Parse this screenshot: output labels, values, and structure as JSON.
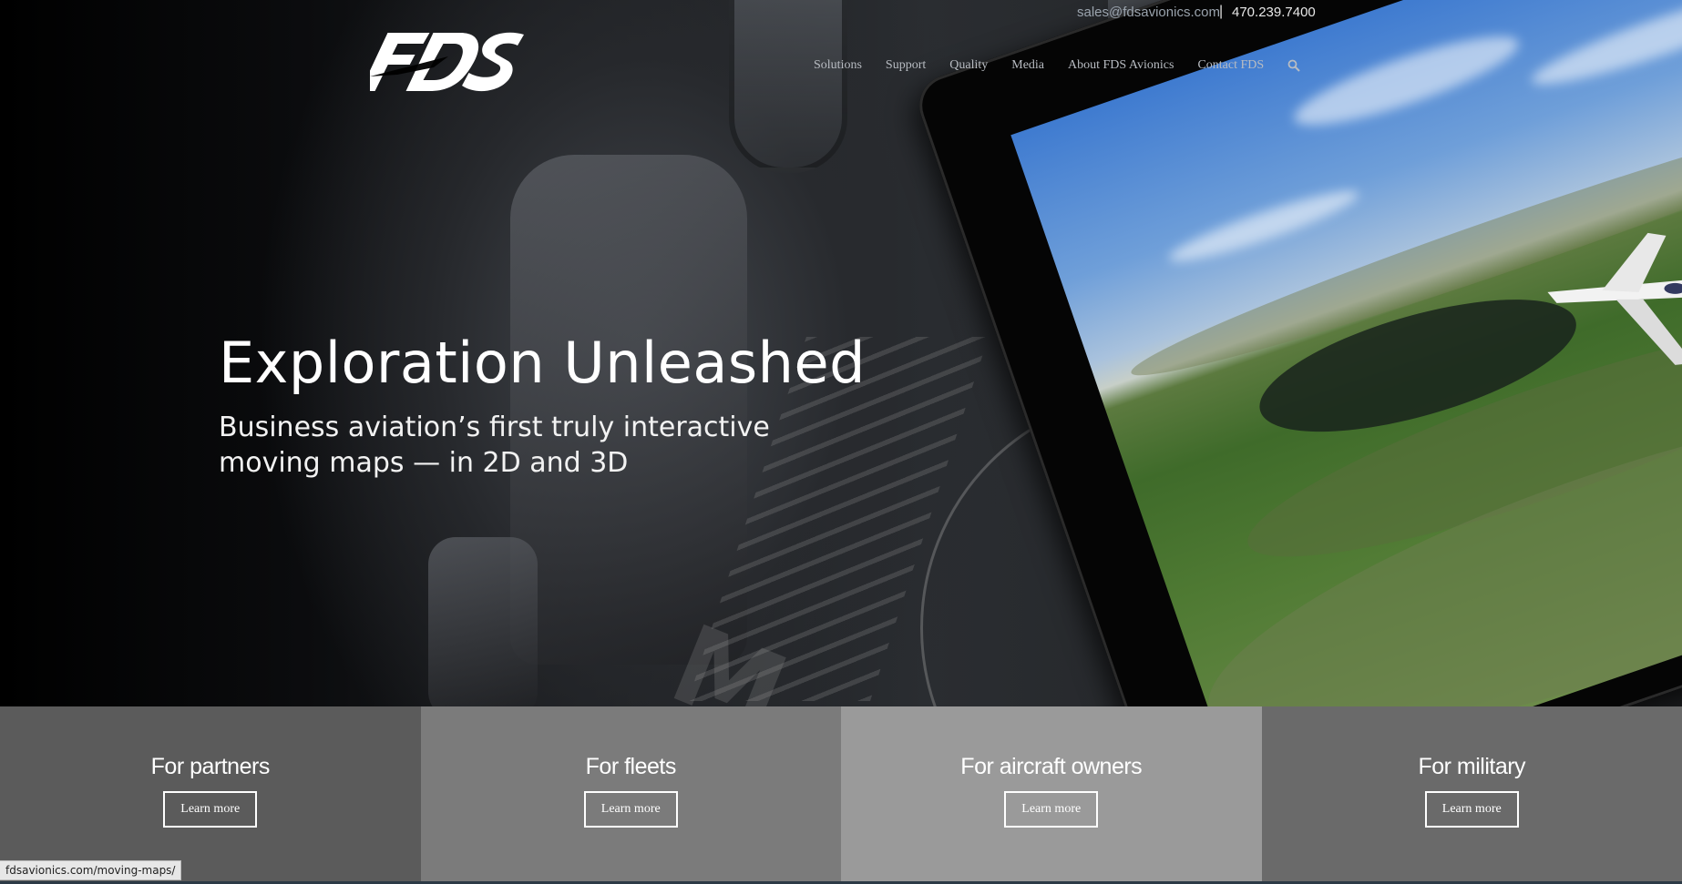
{
  "header": {
    "logo_text": "FDS",
    "email": "sales@fdsavionics.com",
    "separator": "|",
    "phone": "470.239.7400",
    "nav": [
      {
        "label": "Solutions"
      },
      {
        "label": "Support"
      },
      {
        "label": "Quality"
      },
      {
        "label": "Media"
      },
      {
        "label": "About FDS Avionics"
      },
      {
        "label": "Contact FDS"
      }
    ],
    "search_icon": "search-icon"
  },
  "hero": {
    "title": "Exploration Unleashed",
    "subtitle": "Business aviation’s first truly interactive moving maps — in 2D and 3D"
  },
  "tiles": [
    {
      "title": "For partners",
      "button": "Learn more"
    },
    {
      "title": "For fleets",
      "button": "Learn more"
    },
    {
      "title": "For aircraft owners",
      "button": "Learn more"
    },
    {
      "title": "For military",
      "button": "Learn more"
    }
  ],
  "status_url": "fdsavionics.com/moving-maps/",
  "colors": {
    "tile_1": "#5b5b5b",
    "tile_2": "#7b7b7b",
    "tile_3": "#9a9a9a",
    "tile_4": "#6a6a6a",
    "nav_text": "#b8bcc2"
  }
}
